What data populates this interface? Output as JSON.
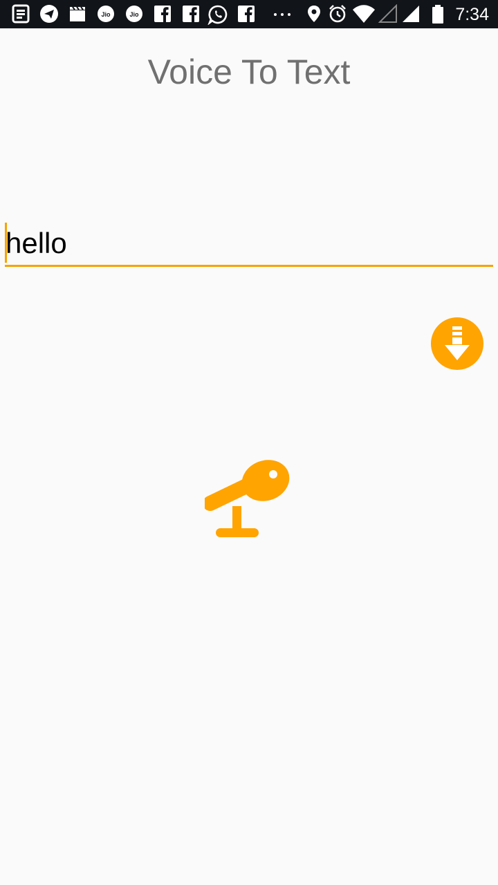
{
  "status_bar": {
    "time": "7:34",
    "icons": [
      "news-icon",
      "telegram-icon",
      "clapper-icon",
      "jio-icon",
      "jio-icon",
      "facebook-icon",
      "facebook-icon",
      "whatsapp-icon",
      "facebook-icon",
      "more-dots-icon",
      "location-icon",
      "alarm-icon",
      "wifi-icon",
      "signal-empty-icon",
      "signal-icon",
      "battery-icon"
    ],
    "jio_label": "Jio"
  },
  "app": {
    "title": "Voice To Text",
    "text_value": "hello",
    "download_button_icon": "download-icon",
    "mic_button_icon": "microphone-icon"
  },
  "colors": {
    "accent": "#FFA400",
    "title": "#707070",
    "status_bar_bg": "#111418",
    "background": "#FAFAFA"
  }
}
